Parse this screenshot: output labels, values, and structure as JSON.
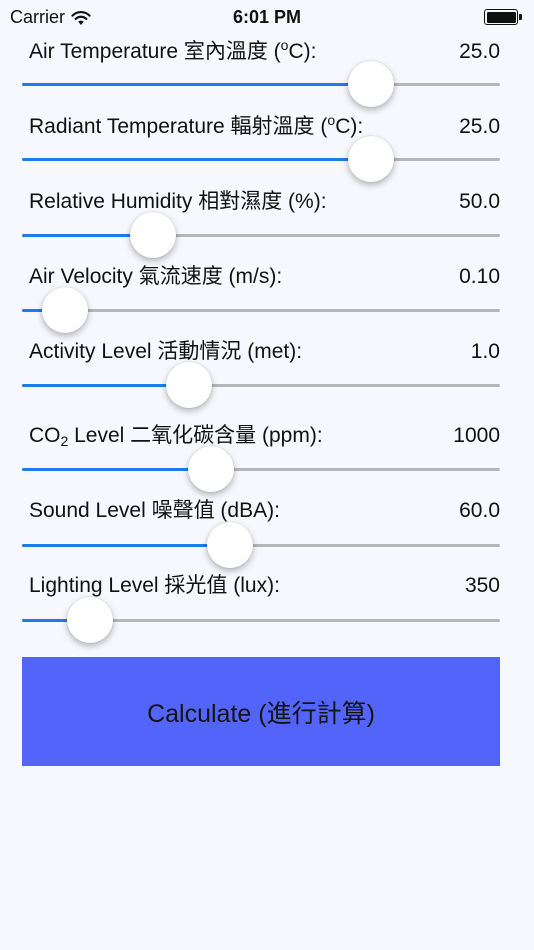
{
  "status_bar": {
    "carrier": "Carrier",
    "time": "6:01 PM"
  },
  "parameters": [
    {
      "label_before": "Air Temperature 室內溫度 (",
      "label_script": "o",
      "label_after": "C):",
      "value": "25.0",
      "slider_fraction": 0.73
    },
    {
      "label_before": "Radiant Temperature 輻射溫度 (",
      "label_script": "o",
      "label_after": "C):",
      "value": "25.0",
      "slider_fraction": 0.73
    },
    {
      "label": "Relative Humidity 相對濕度 (%):",
      "value": "50.0",
      "slider_fraction": 0.275
    },
    {
      "label": "Air Velocity 氣流速度 (m/s):",
      "value": "0.10",
      "slider_fraction": 0.09
    },
    {
      "label": "Activity Level 活動情況 (met):",
      "value": "1.0",
      "slider_fraction": 0.35
    },
    {
      "label_before": "CO",
      "label_script": "2",
      "label_after": " Level 二氧化碳含量 (ppm):",
      "value": "1000",
      "slider_fraction": 0.395
    },
    {
      "label": "Sound Level 噪聲值 (dBA):",
      "value": "60.0",
      "slider_fraction": 0.435
    },
    {
      "label": "Lighting Level 採光值 (lux):",
      "value": "350",
      "slider_fraction": 0.143
    }
  ],
  "calculate_button": {
    "label": "Calculate (進行計算)"
  },
  "colors": {
    "slider_fill": "#1d7bf0",
    "slider_track": "#b6b6b6",
    "button_background": "#5364fb",
    "page_background": "#f7f8fd"
  },
  "icons": [
    "wifi-icon",
    "battery-icon"
  ]
}
